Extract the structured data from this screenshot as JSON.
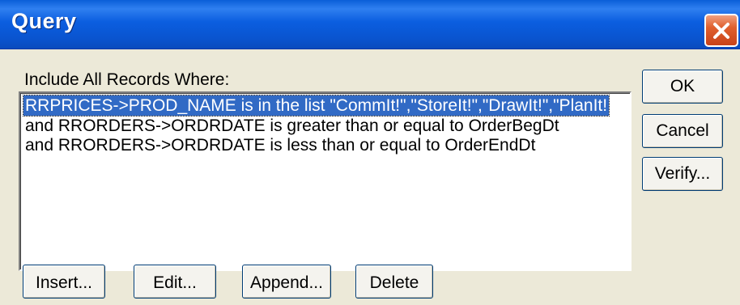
{
  "window": {
    "title": "Query"
  },
  "dialog": {
    "include_label": "Include All Records Where:",
    "conditions": [
      "RRPRICES->PROD_NAME is in the list \"CommIt!\",\"StoreIt!\",\"DrawIt!\",\"PlanIt!",
      "and RRORDERS->ORDRDATE is greater than or equal to OrderBegDt",
      "and RRORDERS->ORDRDATE is less than or equal to OrderEndDt"
    ],
    "selected_index": 0
  },
  "buttons": {
    "ok": "OK",
    "cancel": "Cancel",
    "verify": "Verify...",
    "insert": "Insert...",
    "edit": "Edit...",
    "append": "Append...",
    "delete": "Delete"
  },
  "colors": {
    "titlebar": "#0a54cf",
    "selection": "#316ac5",
    "dialog_bg": "#ece9d8",
    "close_button": "#e0602e"
  },
  "icons": {
    "close": "close-icon"
  }
}
